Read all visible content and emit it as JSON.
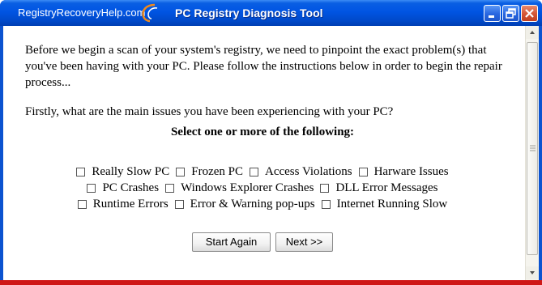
{
  "window": {
    "brand": "RegistryRecoveryHelp.com",
    "title": "PC Registry Diagnosis Tool"
  },
  "content": {
    "intro": "Before we begin a scan of your system's registry, we need to pinpoint the exact problem(s) that you've been having with your PC. Please follow the instructions below in order to begin the repair process...",
    "question": "Firstly, what are the main issues you have been experiencing with your PC?",
    "select_heading": "Select one or more of the following:"
  },
  "options": {
    "row1": [
      "Really Slow PC",
      "Frozen PC",
      "Access Violations",
      "Harware Issues"
    ],
    "row2": [
      "PC Crashes",
      "Windows Explorer Crashes",
      "DLL Error Messages"
    ],
    "row3": [
      "Runtime Errors",
      "Error & Warning pop-ups",
      "Internet Running Slow"
    ]
  },
  "buttons": {
    "start_again": "Start Again",
    "next": "Next >>"
  },
  "icons": {
    "minimize": "minimize-icon",
    "maximize": "maximize-icon",
    "close": "close-icon",
    "logo": "swirl-logo-icon"
  },
  "colors": {
    "titlebar": "#0054e3",
    "bottom_strip": "#cf1717"
  }
}
